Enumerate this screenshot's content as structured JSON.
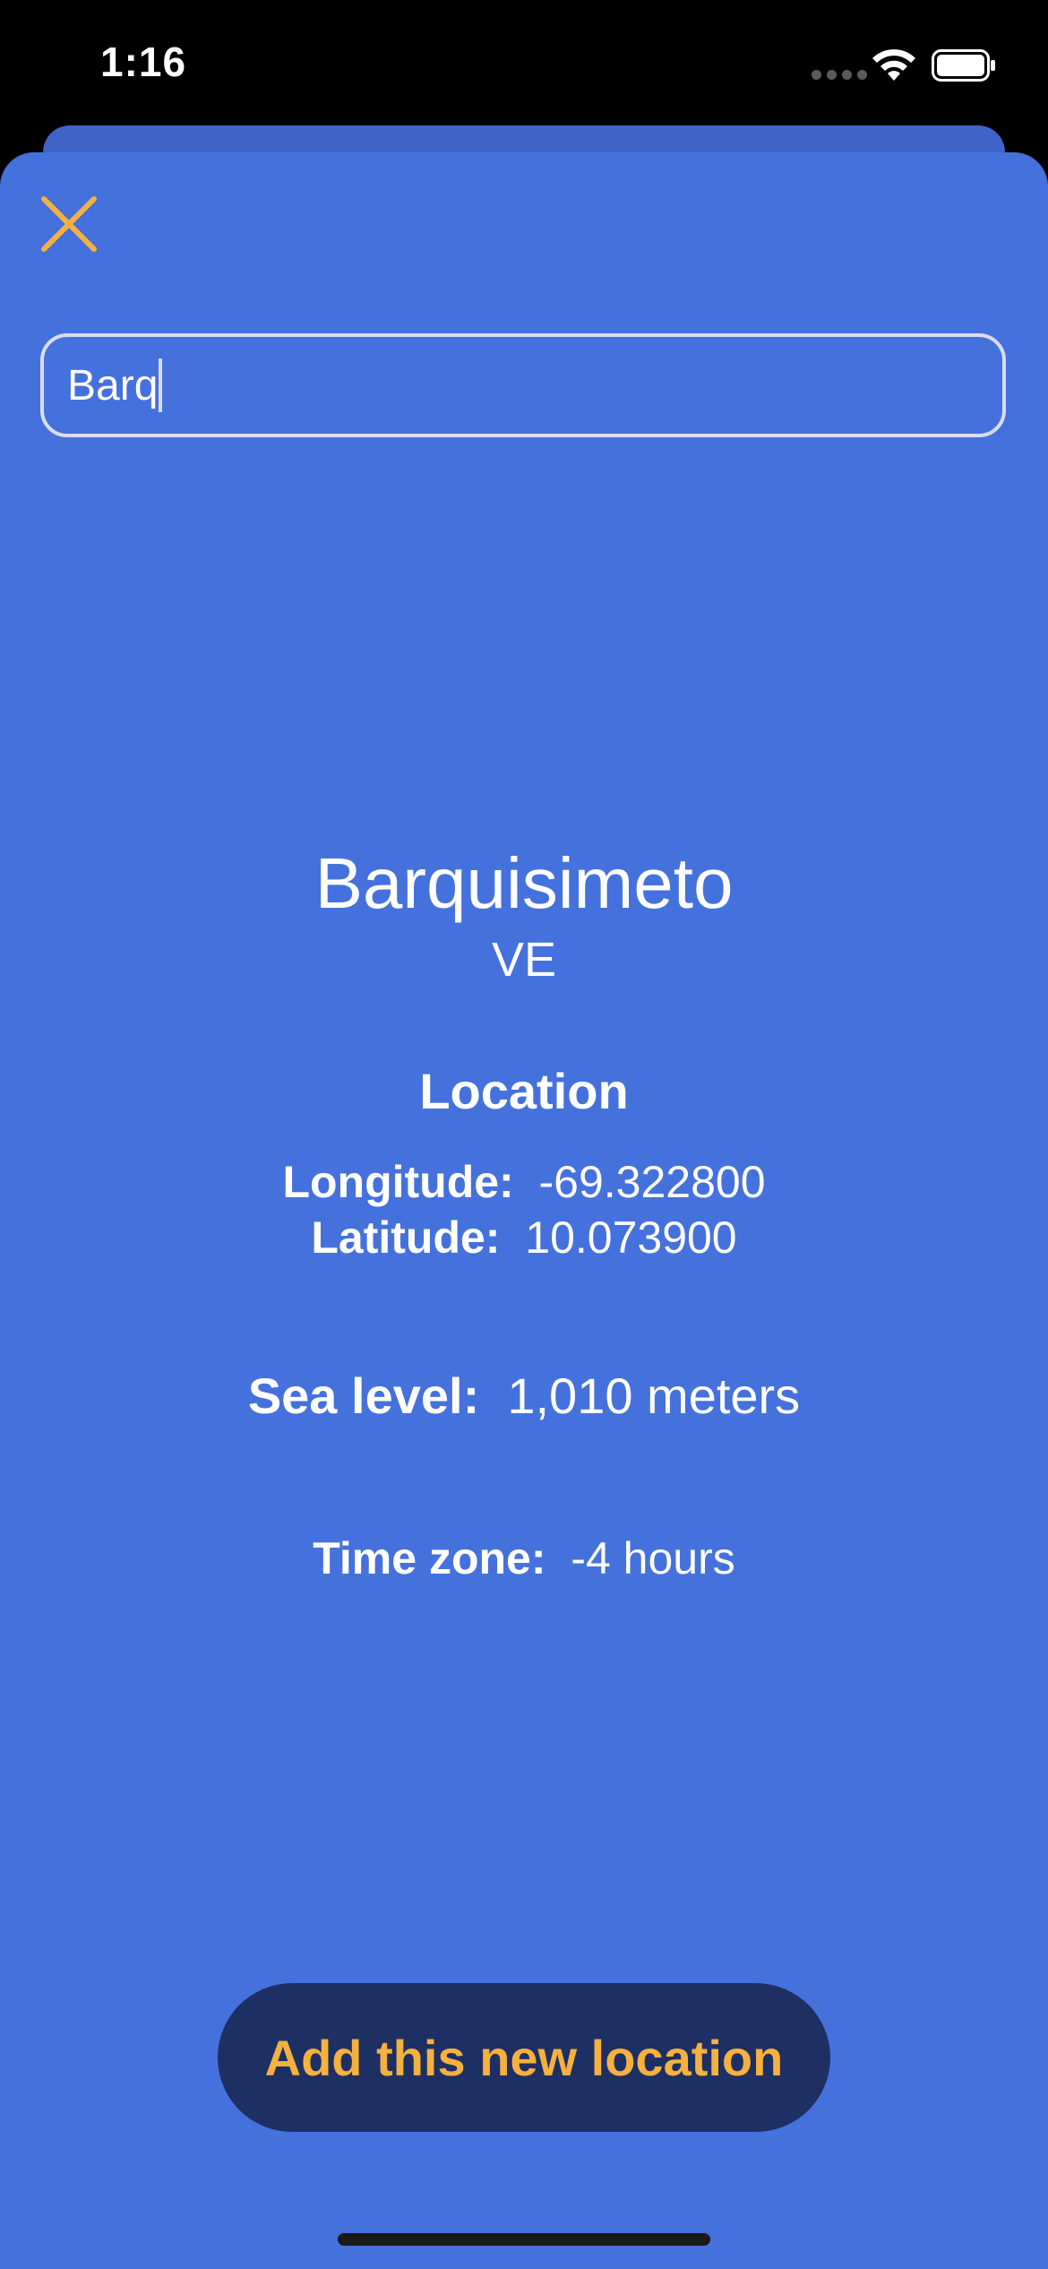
{
  "status_bar": {
    "time": "1:16"
  },
  "search": {
    "value": "Barq"
  },
  "result": {
    "city": "Barquisimeto",
    "country": "VE",
    "location_heading": "Location",
    "longitude_label": "Longitude:",
    "longitude_value": "-69.322800",
    "latitude_label": "Latitude:",
    "latitude_value": "10.073900",
    "sea_level_label": "Sea level:",
    "sea_level_value": "1,010 meters",
    "timezone_label": "Time zone:",
    "timezone_value": "-4 hours"
  },
  "actions": {
    "add_label": "Add this new location"
  },
  "colors": {
    "sheet_background": "#4571dc",
    "accent": "#f5b13f",
    "button_background": "#1e2f63"
  },
  "icons": {
    "close": "close-icon",
    "wifi": "wifi-icon",
    "battery": "battery-icon"
  }
}
